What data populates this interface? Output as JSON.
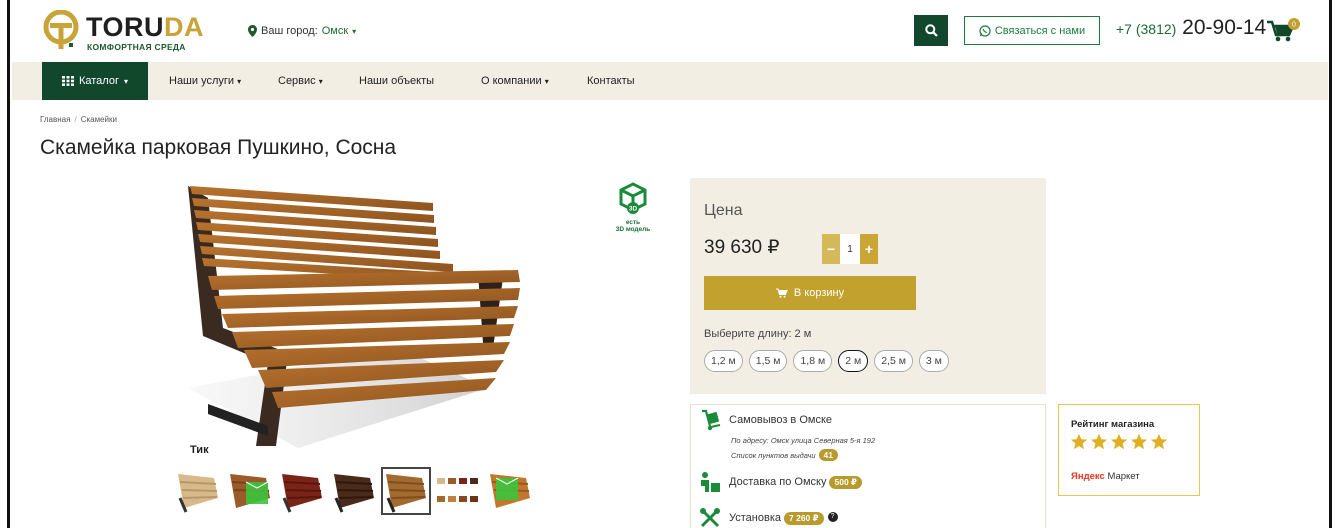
{
  "header": {
    "logo_text_a": "TORU",
    "logo_text_b": "DA",
    "logo_sub": "КОМФОРТНАЯ СРЕДА",
    "city_label": "Ваш город:",
    "city_value": "Омск",
    "contact_label": "Связаться с нами",
    "phone_code": "+7 (3812)",
    "phone_number": "20-90-14",
    "cart_count": "0",
    "brand_green": "#11472a",
    "brand_gold": "#c3a12f"
  },
  "nav": {
    "catalog": "Каталог",
    "items": [
      {
        "label": "Наши услуги",
        "caret": "▾"
      },
      {
        "label": "Сервис",
        "caret": "▾"
      },
      {
        "label": "Наши объекты",
        "caret": ""
      },
      {
        "label": "О компании",
        "caret": "▾"
      },
      {
        "label": "Контакты",
        "caret": ""
      }
    ]
  },
  "breadcrumb": [
    "Главная",
    "Скамейки"
  ],
  "product": {
    "title": "Скамейка парковая Пушкино, Сосна",
    "color_label": "Тик",
    "badge_3d_line1": "есть",
    "badge_3d_line2": "3D модель",
    "price_label": "Цена",
    "price": "39 630 ₽",
    "qty": "1",
    "qty_minus": "−",
    "qty_plus": "+",
    "cart_button": "В корзину",
    "length_label": "Выберите длину: 2 м",
    "lengths": [
      "1,2 м",
      "1,5 м",
      "1,8 м",
      "2 м",
      "2,5 м",
      "3 м"
    ],
    "selected_length": "2 м"
  },
  "delivery": {
    "pickup_title": "Самовывоз в Омске",
    "pickup_address": "По адресу: Омск улица Северная 5-я 192",
    "pickup_points": "Список пунктов выдачи",
    "pickup_points_count": "41",
    "delivery_title": "Доставка по Омску",
    "delivery_price": "500 ₽",
    "install_title": "Установка",
    "install_price": "7 260 ₽",
    "help_mark": "?"
  },
  "rating": {
    "title": "Рейтинг магазина",
    "stars": 5,
    "source_a": "Яндекс",
    "source_b": "Маркет"
  },
  "icons": [
    "location-pin-icon",
    "search-icon",
    "whatsapp-icon",
    "cart-icon",
    "grid-icon",
    "cube-3d-icon",
    "dolly-icon",
    "courier-icon",
    "tools-icon",
    "star-icon"
  ]
}
